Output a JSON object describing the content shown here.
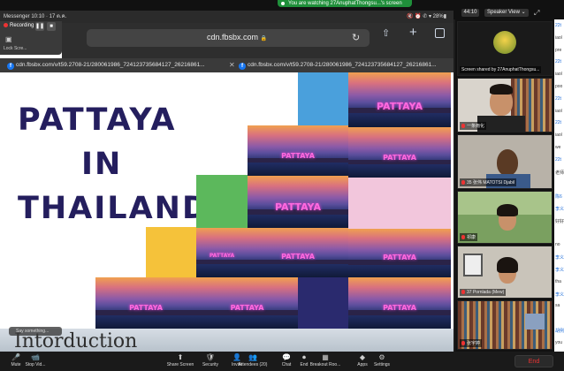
{
  "zoom": {
    "watching_banner": "You are watching 27AnuphatThongsu...'s screen",
    "timer": "44:10",
    "view_label": "Speaker View",
    "view_chevron": "⌄"
  },
  "phone_status": {
    "left": "Messenger  10:10 · 17 ต.ค.",
    "right": "🔇 ⏰ ✆ ▾ 28%▮"
  },
  "recording": {
    "label": "Recording",
    "pause": "❚❚",
    "stop": "■",
    "lock_label": "Lock Scre..."
  },
  "browser": {
    "left_label": "กก",
    "url": "cdn.fbsbx.com",
    "lock_glyph": "🔒",
    "reload_glyph": "↻",
    "share_glyph": "⇧",
    "plus_glyph": "+",
    "tabs": [
      {
        "label": "cdn.fbsbx.com/v/t59.2708-21/280061986_724123735684127_26216861...",
        "icon": "f"
      },
      {
        "label": "cdn.fbsbx.com/v/t59.2708-21/280061986_724123735684127_26216861...",
        "icon": "f"
      }
    ]
  },
  "slide": {
    "title_lines": [
      "PATTAYA",
      "IN",
      "THAILAND"
    ],
    "sign_text": "PATTAYA",
    "intro": "Intorduction",
    "say_something": "Say something..."
  },
  "participants": [
    {
      "name": "Screen shared by 27AnuphatThongsu...",
      "kind": "avatar"
    },
    {
      "name": "一条雨化",
      "kind": "man-bookshelf"
    },
    {
      "name": "35 张伟 MATOTSI Djabil",
      "kind": "man-dark"
    },
    {
      "name": "祁康",
      "kind": "woman-window"
    },
    {
      "name": "37 Pornlada (Mew)",
      "kind": "woman-room"
    },
    {
      "name": "张宇婷",
      "kind": "bookshelf"
    }
  ],
  "chat_lines": [
    {
      "text": "22t",
      "color": "#1a6ad8"
    },
    {
      "text": "iaol",
      "color": "#333"
    },
    {
      "text": "pre",
      "color": "#333"
    },
    {
      "text": "22t",
      "color": "#1a6ad8"
    },
    {
      "text": "iaol",
      "color": "#333"
    },
    {
      "text": "poo",
      "color": "#333"
    },
    {
      "text": "22t",
      "color": "#1a6ad8"
    },
    {
      "text": "iaol",
      "color": "#333"
    },
    {
      "text": "22t",
      "color": "#1a6ad8"
    },
    {
      "text": "iaol",
      "color": "#333"
    },
    {
      "text": "we",
      "color": "#333"
    },
    {
      "text": "22t",
      "color": "#1a6ad8"
    },
    {
      "text": "老师",
      "color": "#333"
    },
    {
      "text": "",
      "color": "#333"
    },
    {
      "text": "陈6",
      "color": "#1a6ad8"
    },
    {
      "text": "李义",
      "color": "#1a6ad8"
    },
    {
      "text": "好好",
      "color": "#333"
    },
    {
      "text": "",
      "color": "#333"
    },
    {
      "text": "no",
      "color": "#333"
    },
    {
      "text": "李义",
      "color": "#1a6ad8"
    },
    {
      "text": "李义",
      "color": "#1a6ad8"
    },
    {
      "text": "tha",
      "color": "#333"
    },
    {
      "text": "李义",
      "color": "#1a6ad8"
    },
    {
      "text": "sa",
      "color": "#333"
    },
    {
      "text": "",
      "color": "#333"
    },
    {
      "text": "胡例",
      "color": "#1a6ad8"
    },
    {
      "text": "you",
      "color": "#333"
    }
  ],
  "toolbar": [
    {
      "label": "Mute",
      "icon": "🎤",
      "name": "mute"
    },
    {
      "label": "Stop Vid...",
      "icon": "📹",
      "name": "stop-video"
    },
    {
      "label": "Share Screen",
      "icon": "⬆",
      "name": "share-screen"
    },
    {
      "label": "Security",
      "icon": "🛡",
      "name": "security"
    },
    {
      "label": "Invite",
      "icon": "👤",
      "name": "invite"
    },
    {
      "label": "Attendees (20)",
      "icon": "👥",
      "name": "attendees"
    },
    {
      "label": "Chat",
      "icon": "💬",
      "name": "chat"
    },
    {
      "label": "End",
      "icon": "⏺",
      "name": "record"
    },
    {
      "label": "Breakout Roo...",
      "icon": "▦",
      "name": "breakout-rooms"
    },
    {
      "label": "Apps",
      "icon": "◆",
      "name": "apps"
    },
    {
      "label": "Settings",
      "icon": "⚙",
      "name": "settings"
    }
  ],
  "end_label": "End",
  "colors": {
    "title_navy": "#241e5e",
    "block_blue": "#4aa0dc",
    "block_green": "#5cb85c",
    "block_yellow": "#f5c23a",
    "block_pink": "#f2c6dc",
    "block_navy": "#2a2a6e",
    "zoom_green": "#1f8f3a",
    "end_red": "#e33333"
  }
}
